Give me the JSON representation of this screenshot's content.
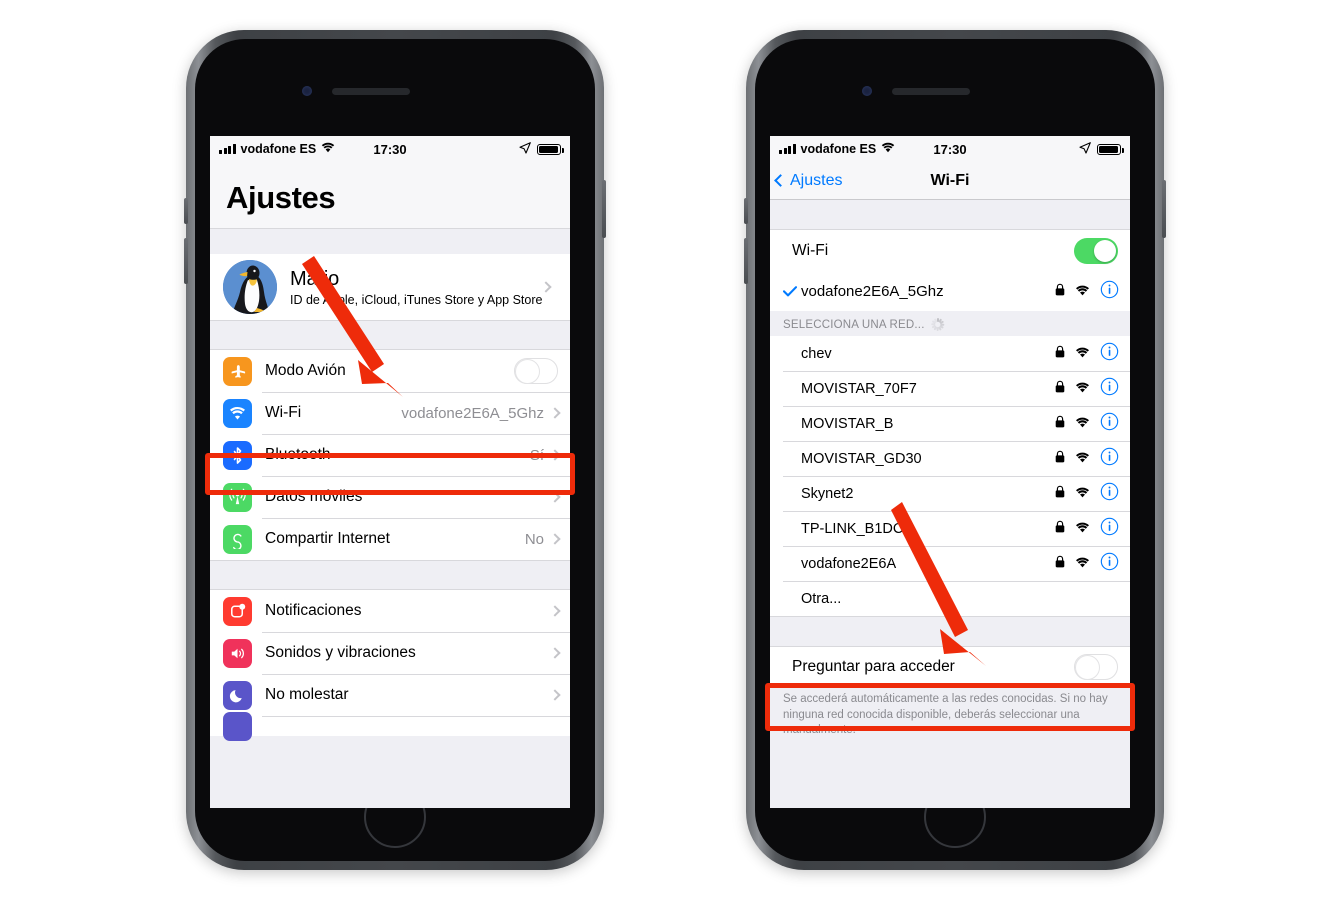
{
  "status_bar": {
    "carrier": "vodafone ES",
    "time": "17:30",
    "signal_icon": "signal-bars-icon",
    "wifi_icon": "wifi-icon",
    "location_icon": "location-arrow-icon",
    "battery_icon": "battery-icon"
  },
  "accent_colors": {
    "highlight_red": "#ee2b0a",
    "ios_blue": "#007aff",
    "toggle_green": "#4cd964",
    "gray_text": "#8e8e93"
  },
  "left_phone": {
    "title": "Ajustes",
    "account": {
      "name": "Mario",
      "subtitle": "ID de Apple, iCloud, iTunes Store y App Store",
      "avatar_icon": "penguin-avatar"
    },
    "group_connectivity": [
      {
        "label": "Modo Avión",
        "icon": "airplane-icon",
        "icon_color": "#f7961e",
        "control": "toggle",
        "toggle_on": false
      },
      {
        "label": "Wi-Fi",
        "icon": "wifi-icon",
        "icon_color": "#1a84ff",
        "value": "vodafone2E6A_5Ghz",
        "control": "chevron",
        "highlighted": true
      },
      {
        "label": "Bluetooth",
        "icon": "bluetooth-icon",
        "icon_color": "#1a6bff",
        "value": "Sí",
        "control": "chevron"
      },
      {
        "label": "Datos móviles",
        "icon": "cellular-icon",
        "icon_color": "#4cd964",
        "value": "",
        "control": "chevron"
      },
      {
        "label": "Compartir Internet",
        "icon": "hotspot-icon",
        "icon_color": "#4cd964",
        "value": "No",
        "control": "chevron"
      }
    ],
    "group_alerts": [
      {
        "label": "Notificaciones",
        "icon": "notifications-icon",
        "icon_color": "#ff3b30",
        "control": "chevron"
      },
      {
        "label": "Sonidos y vibraciones",
        "icon": "sounds-icon",
        "icon_color": "#f0325b",
        "control": "chevron"
      },
      {
        "label": "No molestar",
        "icon": "moon-icon",
        "icon_color": "#5a55c9",
        "control": "chevron"
      },
      {
        "label": "",
        "icon": "screen-time-icon",
        "icon_color": "#5a55c9",
        "control": "chevron"
      }
    ]
  },
  "right_phone": {
    "nav": {
      "back_label": "Ajustes",
      "back_icon": "chevron-left-icon",
      "title": "Wi-Fi"
    },
    "wifi_toggle": {
      "label": "Wi-Fi",
      "on": true
    },
    "connected_network": {
      "ssid": "vodafone2E6A_5Ghz",
      "checked": true,
      "lock_icon": "lock-icon",
      "signal_icon": "wifi-icon",
      "info_icon": "info-circle-icon"
    },
    "section_header": {
      "label": "SELECCIONA UNA RED...",
      "spinner_icon": "loading-spinner-icon"
    },
    "networks": [
      {
        "ssid": "chev",
        "locked": true,
        "info": true
      },
      {
        "ssid": "MOVISTAR_70F7",
        "locked": true,
        "info": true
      },
      {
        "ssid": "MOVISTAR_B",
        "locked": true,
        "info": true
      },
      {
        "ssid": "MOVISTAR_GD30",
        "locked": true,
        "info": true
      },
      {
        "ssid": "Skynet2",
        "locked": true,
        "info": true
      },
      {
        "ssid": "TP-LINK_B1DC2",
        "locked": true,
        "info": true
      },
      {
        "ssid": "vodafone2E6A",
        "locked": true,
        "info": true
      },
      {
        "ssid": "Otra...",
        "locked": false,
        "info": false
      }
    ],
    "ask_to_join": {
      "label": "Preguntar para acceder",
      "on": false,
      "highlighted": true
    },
    "footnote": "Se accederá automáticamente a las redes conocidas. Si no hay ninguna red conocida disponible, deberás seleccionar una manualmente."
  },
  "annotations": {
    "left_arrow": {
      "icon": "red-arrow-down-right",
      "points_to": "Wi-Fi"
    },
    "right_arrow": {
      "icon": "red-arrow-down-right",
      "points_to": "Preguntar para acceder"
    }
  }
}
